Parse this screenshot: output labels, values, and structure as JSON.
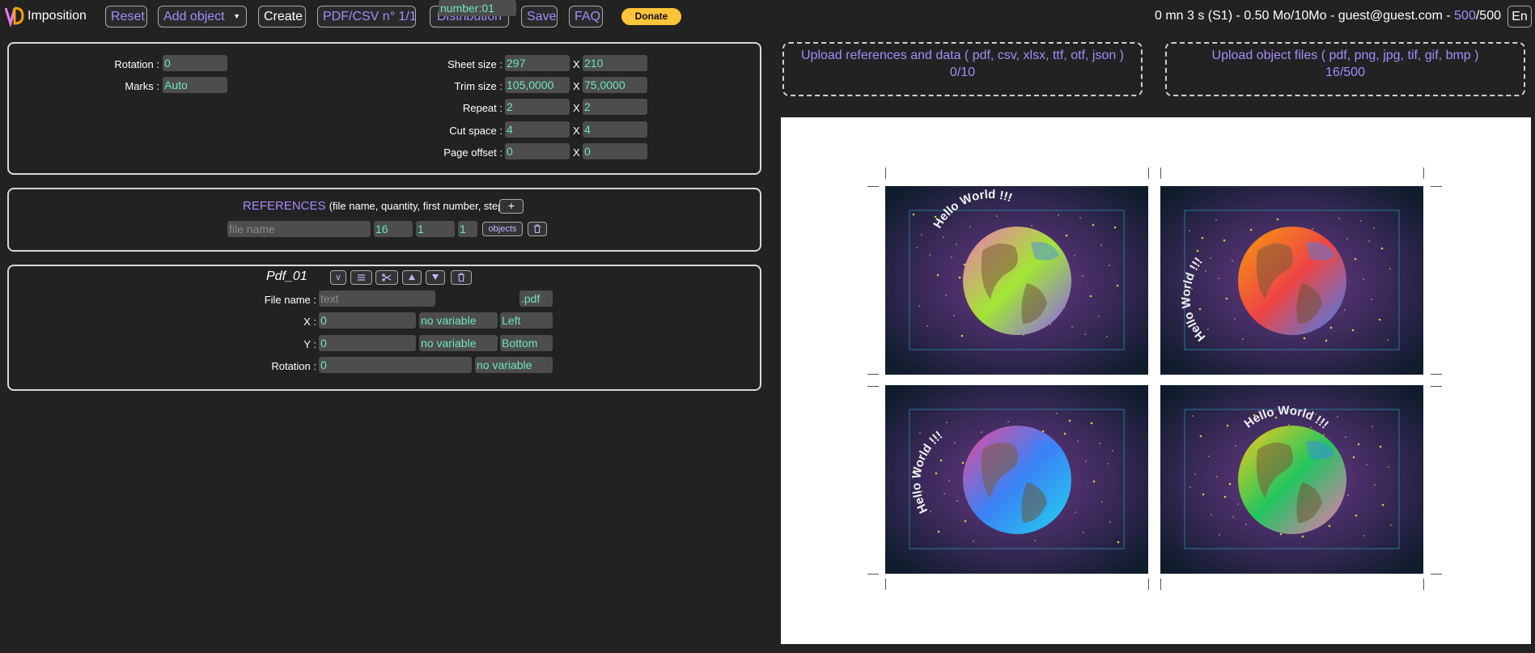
{
  "app": {
    "name": "Imposition"
  },
  "toolbar": {
    "reset": "Reset",
    "add_object": "Add object",
    "create": "Create",
    "pdf_csv": "PDF/CSV n° 1/1",
    "distribution": "Distribution",
    "save": "Save",
    "faq": "FAQ",
    "donate": "Donate"
  },
  "status": {
    "text": "0 mn 3 s (S1) - 0.50 Mo/10Mo - guest@guest.com - ",
    "count": "500",
    "total": "/500",
    "lang": "En"
  },
  "sheet": {
    "rotation_label": "Rotation :",
    "rotation": "0",
    "marks_label": "Marks :",
    "marks": "Auto",
    "sheet_size_label": "Sheet size :",
    "sheet_w": "297",
    "sheet_h": "210",
    "trim_size_label": "Trim size :",
    "trim_w": "105,0000",
    "trim_h": "75,0000",
    "repeat_label": "Repeat :",
    "repeat_x": "2",
    "repeat_y": "2",
    "cut_space_label": "Cut space :",
    "cut_x": "4",
    "cut_y": "4",
    "page_offset_label": "Page offset :",
    "offset_x": "0",
    "offset_y": "0",
    "x_sep": "X"
  },
  "references": {
    "title": "REFERENCES",
    "subtitle": "(file name, quantity, first number, step)",
    "add": "+",
    "file_placeholder": "file name",
    "quantity": "16",
    "first_number": "1",
    "step": "1",
    "objects_button": "objects"
  },
  "object": {
    "title": "Pdf_01",
    "file_name_label": "File name :",
    "file_placeholder": "text",
    "numbering": "number:01",
    "extension": ".pdf",
    "x_label": "X :",
    "x": "0",
    "x_var": "no variable",
    "x_align": "Left",
    "y_label": "Y :",
    "y": "0",
    "y_var": "no variable",
    "y_align": "Bottom",
    "rotation_label": "Rotation :",
    "rotation": "0",
    "rotation_var": "no variable",
    "btn_v": "v"
  },
  "uploads": {
    "references": {
      "label": "Upload references and data ( pdf, csv, xlsx, ttf, otf, json )",
      "count": "0/10"
    },
    "objects": {
      "label": "Upload object files ( pdf, png, jpg, tif, gif, bmp )",
      "count": "16/500"
    }
  },
  "preview": {
    "cards": [
      {
        "text": "Hello World !!!"
      },
      {
        "text": "Hello World !!!"
      },
      {
        "text": "Hello World !!!"
      },
      {
        "text": "Hello World !!!"
      }
    ]
  },
  "colors": {
    "accent": "#a78bfa",
    "field_text": "#6ee7b7",
    "background": "#222222",
    "donate": "#ffc439"
  }
}
